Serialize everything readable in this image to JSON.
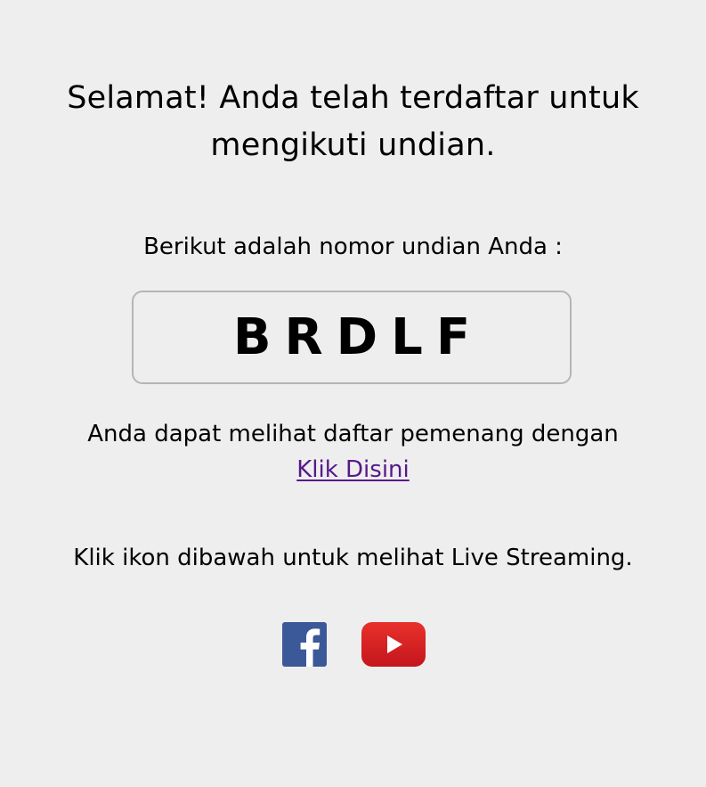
{
  "heading": {
    "line1": "Selamat! Anda telah terdaftar untuk",
    "line2": "mengikuti undian."
  },
  "lottery": {
    "intro": "Berikut adalah nomor undian Anda :",
    "code": "BRDLF"
  },
  "winners": {
    "text": "Anda dapat melihat daftar pemenang dengan",
    "link_label": "Klik Disini"
  },
  "streaming": {
    "text": "Klik ikon dibawah untuk melihat Live Streaming."
  },
  "social": {
    "facebook_icon": "facebook-icon",
    "youtube_icon": "youtube-icon"
  },
  "colors": {
    "background": "#efeeee",
    "link": "#551a8b",
    "facebook": "#3b5998",
    "youtube": "#e52d27"
  }
}
